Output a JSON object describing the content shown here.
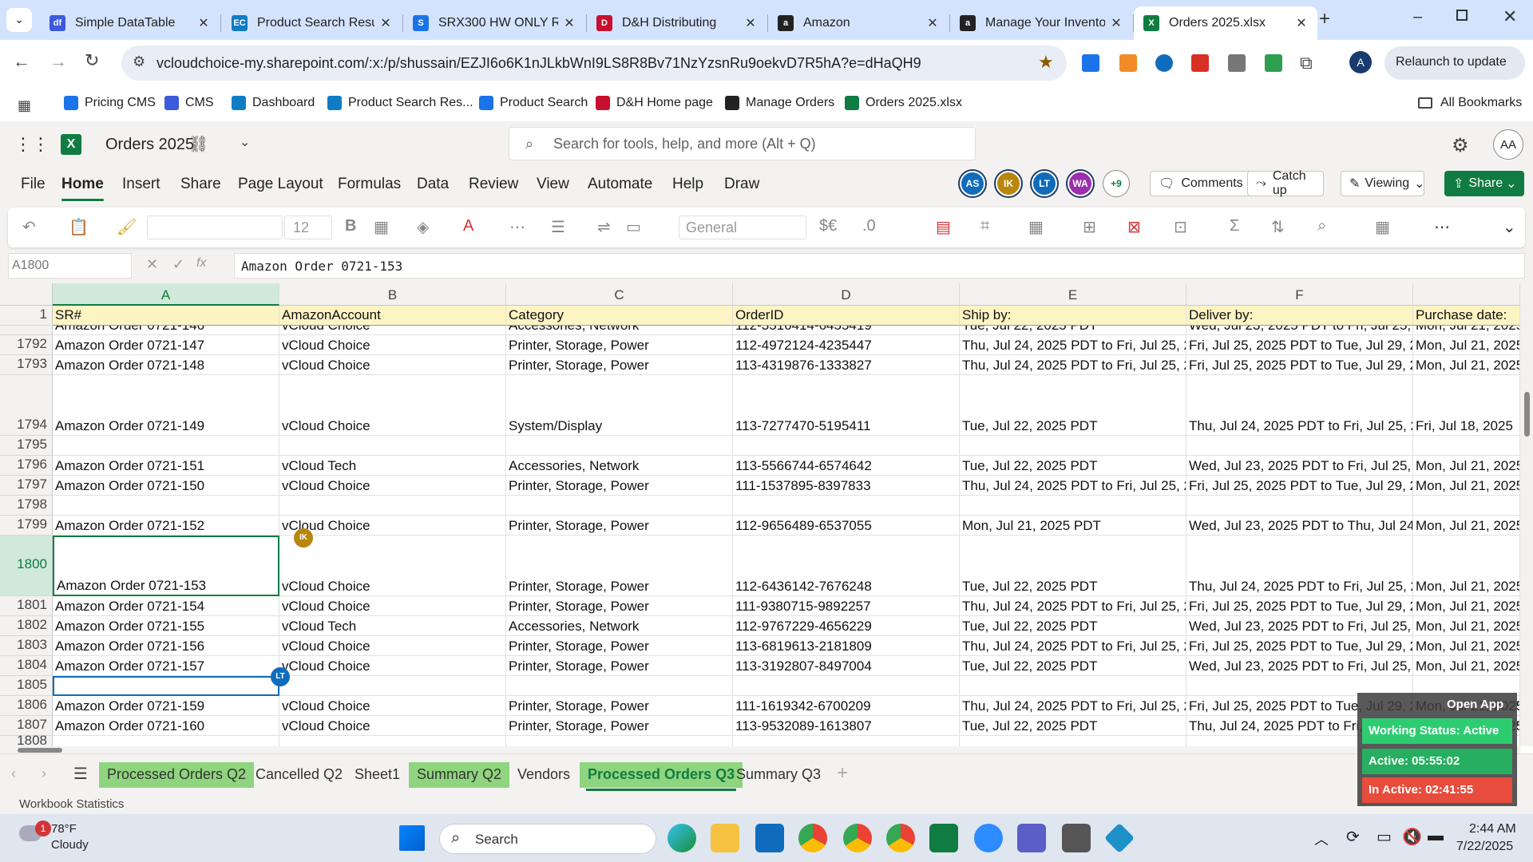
{
  "browser": {
    "tabs": [
      {
        "title": "Simple DataTable",
        "fav": "#3b5bdb",
        "favtext": "df"
      },
      {
        "title": "Product Search Resul",
        "fav": "#0f7cc4",
        "favtext": "EC"
      },
      {
        "title": "SRX300 HW ONLY RE",
        "fav": "#1a73e8",
        "favtext": "S"
      },
      {
        "title": "D&H Distributing",
        "fav": "#c8102e",
        "favtext": "D"
      },
      {
        "title": "Amazon",
        "fav": "#222222",
        "favtext": "a"
      },
      {
        "title": "Manage Your Invento",
        "fav": "#222222",
        "favtext": "a"
      },
      {
        "title": "Orders 2025.xlsx",
        "fav": "#107c41",
        "favtext": "X"
      }
    ],
    "url": "vcloudchoice-my.sharepoint.com/:x:/p/shussain/EZJI6o6K1nJLkbWnI9LS8R8Bv71NzYzsnRu9oekvD7R5hA?e=dHaQH9",
    "profile_initial": "A",
    "relaunch_label": "Relaunch to update",
    "bookmarks": [
      {
        "label": "Pricing CMS",
        "fav": "#1a73e8"
      },
      {
        "label": "CMS",
        "fav": "#3b5bdb"
      },
      {
        "label": "Dashboard",
        "fav": "#0f7cc4"
      },
      {
        "label": "Product Search Res...",
        "fav": "#0f7cc4"
      },
      {
        "label": "Product Search",
        "fav": "#1a73e8"
      },
      {
        "label": "D&H Home page",
        "fav": "#c8102e"
      },
      {
        "label": "Manage Orders",
        "fav": "#222222"
      },
      {
        "label": "Orders 2025.xlsx",
        "fav": "#107c41"
      }
    ],
    "all_bookmarks": "All Bookmarks"
  },
  "excel": {
    "doc_title": "Orders 2025",
    "search_placeholder": "Search for tools, help, and more (Alt + Q)",
    "user_initials": "AA",
    "menus": [
      "File",
      "Home",
      "Insert",
      "Share",
      "Page Layout",
      "Formulas",
      "Data",
      "Review",
      "View",
      "Automate",
      "Help",
      "Draw"
    ],
    "active_menu": "Home",
    "collaborators": [
      {
        "initials": "AS",
        "color": "#0f6cbd"
      },
      {
        "initials": "IK",
        "color": "#b8860b"
      },
      {
        "initials": "LT",
        "color": "#0f6cbd"
      },
      {
        "initials": "WA",
        "color": "#9b2fae"
      }
    ],
    "more_collab": "+9",
    "comments_label": "Comments",
    "catchup_label": "Catch up",
    "viewing_label": "Viewing",
    "share_label": "Share",
    "font_size": "12",
    "number_format": "General",
    "name_box": "A1800",
    "formula": "Amazon Order 0721-153",
    "columns": [
      "A",
      "B",
      "C",
      "D",
      "E",
      "F"
    ],
    "header_row": [
      "SR#",
      "AmazonAccount",
      "Category",
      "OrderID",
      "Ship by:",
      "Deliver by:",
      "Purchase date:"
    ],
    "rows": [
      {
        "n": "",
        "a": "Amazon Order 0721-146",
        "b": "vCloud Choice",
        "c": "Accessories, Network",
        "d": "112-3516414-6455419",
        "e": "Tue, Jul 22, 2025 PDT",
        "f": "Wed, Jul 23, 2025 PDT to Fri, Jul 25, 20",
        "g": "Mon, Jul 21, 2025"
      },
      {
        "n": "1792",
        "a": "Amazon Order 0721-147",
        "b": "vCloud Choice",
        "c": "Printer, Storage, Power",
        "d": "112-4972124-4235447",
        "e": "Thu, Jul 24, 2025 PDT to Fri, Jul 25, 20",
        "f": "Fri, Jul 25, 2025 PDT to Tue, Jul 29, 20",
        "g": "Mon, Jul 21, 2025"
      },
      {
        "n": "1793",
        "a": "Amazon Order 0721-148",
        "b": "vCloud Choice",
        "c": "Printer, Storage, Power",
        "d": "113-4319876-1333827",
        "e": "Thu, Jul 24, 2025 PDT to Fri, Jul 25, 20",
        "f": "Fri, Jul 25, 2025 PDT to Tue, Jul 29, 20",
        "g": "Mon, Jul 21, 2025"
      },
      {
        "n": "1794",
        "a": "Amazon Order 0721-149",
        "b": "vCloud Choice",
        "c": "System/Display",
        "d": "113-7277470-5195411",
        "e": "Tue, Jul 22, 2025 PDT",
        "f": "Thu, Jul 24, 2025 PDT to Fri, Jul 25, 20",
        "g": "Fri, Jul 18, 2025"
      },
      {
        "n": "1795",
        "a": "",
        "b": "",
        "c": "",
        "d": "",
        "e": "",
        "f": "",
        "g": ""
      },
      {
        "n": "1796",
        "a": "Amazon Order 0721-151",
        "b": "vCloud Tech",
        "c": "Accessories, Network",
        "d": "113-5566744-6574642",
        "e": "Tue, Jul 22, 2025 PDT",
        "f": "Wed, Jul 23, 2025 PDT to Fri, Jul 25, 20",
        "g": "Mon, Jul 21, 2025"
      },
      {
        "n": "1797",
        "a": "Amazon Order 0721-150",
        "b": "vCloud Choice",
        "c": "Printer, Storage, Power",
        "d": "111-1537895-8397833",
        "e": "Thu, Jul 24, 2025 PDT to Fri, Jul 25, 20",
        "f": "Fri, Jul 25, 2025 PDT to Tue, Jul 29, 20",
        "g": "Mon, Jul 21, 2025"
      },
      {
        "n": "1798",
        "a": "",
        "b": "",
        "c": "",
        "d": "",
        "e": "",
        "f": "",
        "g": ""
      },
      {
        "n": "1799",
        "a": "Amazon Order 0721-152",
        "b": "vCloud Choice",
        "c": "Printer, Storage, Power",
        "d": "112-9656489-6537055",
        "e": "Mon, Jul 21, 2025 PDT",
        "f": "Wed, Jul 23, 2025 PDT to Thu, Jul 24, 2",
        "g": "Mon, Jul 21, 2025"
      },
      {
        "n": "1800",
        "a": "Amazon Order 0721-153",
        "b": "vCloud Choice",
        "c": "Printer, Storage, Power",
        "d": "112-6436142-7676248",
        "e": "Tue, Jul 22, 2025 PDT",
        "f": "Thu, Jul 24, 2025 PDT to Fri, Jul 25, 20",
        "g": "Mon, Jul 21, 2025"
      },
      {
        "n": "1801",
        "a": "Amazon Order 0721-154",
        "b": "vCloud Choice",
        "c": "Printer, Storage, Power",
        "d": "111-9380715-9892257",
        "e": "Thu, Jul 24, 2025 PDT to Fri, Jul 25, 20",
        "f": "Fri, Jul 25, 2025 PDT to Tue, Jul 29, 20",
        "g": "Mon, Jul 21, 2025"
      },
      {
        "n": "1802",
        "a": "Amazon Order 0721-155",
        "b": "vCloud Tech",
        "c": "Accessories, Network",
        "d": "112-9767229-4656229",
        "e": "Tue, Jul 22, 2025 PDT",
        "f": "Wed, Jul 23, 2025 PDT to Fri, Jul 25, 20",
        "g": "Mon, Jul 21, 2025"
      },
      {
        "n": "1803",
        "a": "Amazon Order 0721-156",
        "b": "vCloud Choice",
        "c": "Printer, Storage, Power",
        "d": "113-6819613-2181809",
        "e": "Thu, Jul 24, 2025 PDT to Fri, Jul 25, 20",
        "f": "Fri, Jul 25, 2025 PDT to Tue, Jul 29, 20",
        "g": "Mon, Jul 21, 2025"
      },
      {
        "n": "1804",
        "a": "Amazon Order 0721-157",
        "b": "vCloud Choice",
        "c": "Printer, Storage, Power",
        "d": "113-3192807-8497004",
        "e": "Tue, Jul 22, 2025 PDT",
        "f": "Wed, Jul 23, 2025 PDT to Fri, Jul 25, 20",
        "g": "Mon, Jul 21, 2025"
      },
      {
        "n": "1805",
        "a": "",
        "b": "",
        "c": "",
        "d": "",
        "e": "",
        "f": "",
        "g": ""
      },
      {
        "n": "1806",
        "a": "Amazon Order 0721-159",
        "b": "vCloud Choice",
        "c": "Printer, Storage, Power",
        "d": "111-1619342-6700209",
        "e": "Thu, Jul 24, 2025 PDT to Fri, Jul 25, 20",
        "f": "Fri, Jul 25, 2025 PDT to Tue, Jul 29, 20",
        "g": "Mon, Jul 21, 2025"
      },
      {
        "n": "1807",
        "a": "Amazon Order 0721-160",
        "b": "vCloud Choice",
        "c": "Printer, Storage, Power",
        "d": "113-9532089-1613807",
        "e": "Tue, Jul 22, 2025 PDT",
        "f": "Thu, Jul 24, 2025 PDT to Fri, Jul 25, 20",
        "g": "Mon, Jul 21, 2025"
      },
      {
        "n": "1808",
        "a": "",
        "b": "",
        "c": "",
        "d": "",
        "e": "",
        "f": "",
        "g": ""
      }
    ],
    "cursor_tags": [
      "IK",
      "LT"
    ],
    "sheets": [
      {
        "label": "Processed Orders Q2",
        "green": true
      },
      {
        "label": "Cancelled Q2",
        "green": false
      },
      {
        "label": "Sheet1",
        "green": false
      },
      {
        "label": "Summary Q2",
        "green": true
      },
      {
        "label": "Vendors",
        "green": false
      },
      {
        "label": "Processed Orders Q3",
        "green": true,
        "active": true
      },
      {
        "label": "Summary Q3",
        "green": false
      }
    ],
    "status_left": "Workbook Statistics"
  },
  "widget": {
    "open_app": "Open App",
    "working_status": "Working Status: Active",
    "active": "Active: 05:55:02",
    "inactive": "In Active: 02:41:55"
  },
  "taskbar": {
    "temp": "78°F",
    "weather": "Cloudy",
    "weather_badge": "1",
    "search": "Search",
    "time": "2:44 AM",
    "date": "7/22/2025"
  }
}
